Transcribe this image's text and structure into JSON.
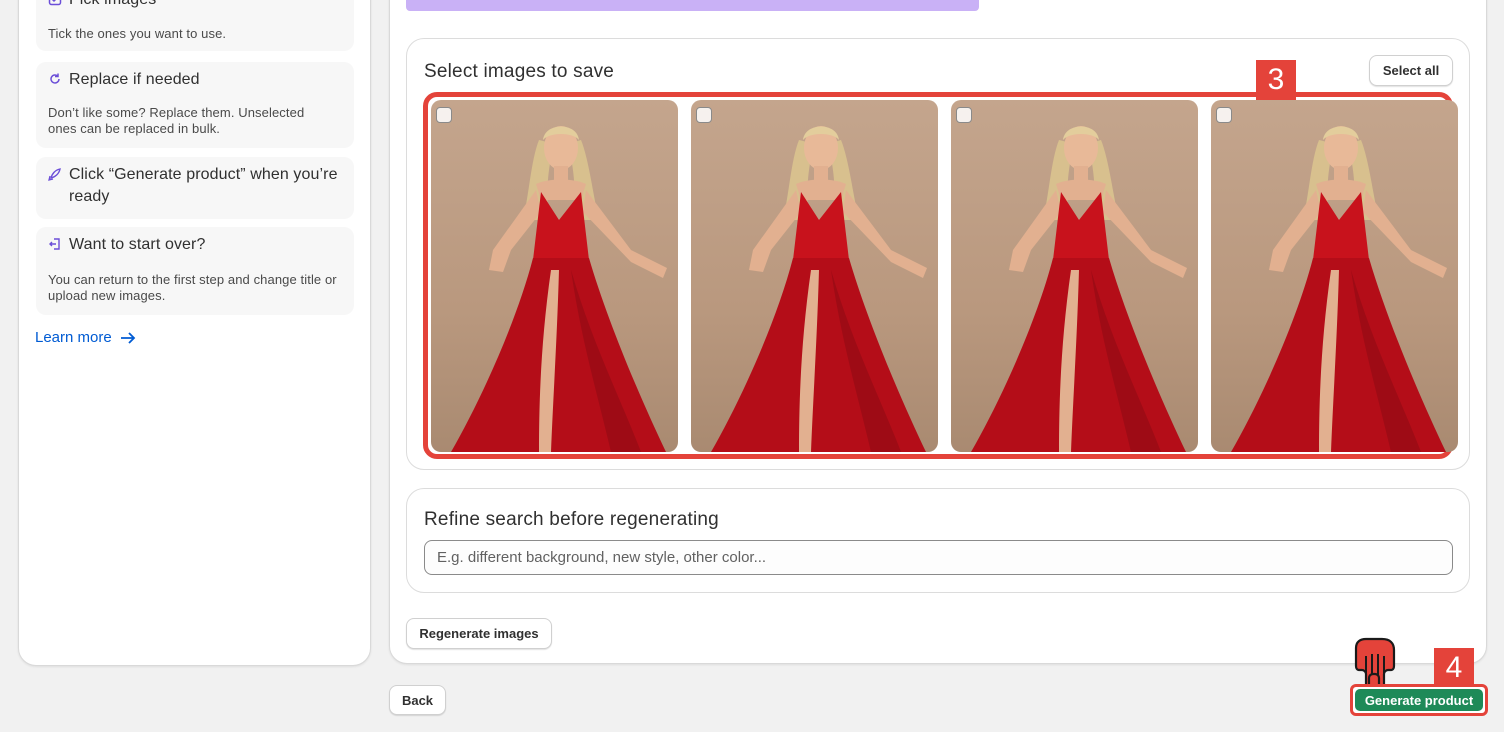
{
  "sidebar": {
    "steps": [
      {
        "title": "Pick images",
        "desc": "Tick the ones you want to use.",
        "icon": "checklist-icon"
      },
      {
        "title": "Replace if needed",
        "desc": "Don’t like some? Replace them. Unselected ones can be replaced in bulk.",
        "icon": "refresh-icon"
      },
      {
        "title": "Click “Generate product” when you’re ready",
        "desc": "",
        "icon": "rocket-icon"
      },
      {
        "title": "Want to start over?",
        "desc": "You can return to the first step and change title or upload new images.",
        "icon": "exit-icon"
      }
    ],
    "learn_more": "Learn more"
  },
  "main": {
    "select_card": {
      "title": "Select images to save",
      "select_all": "Select all",
      "image_count": 4
    },
    "refine_card": {
      "title": "Refine search before regenerating",
      "placeholder": "E.g. different background, new style, other color..."
    },
    "regenerate_label": "Regenerate images"
  },
  "footer": {
    "back_label": "Back",
    "generate_label": "Generate product"
  },
  "annotations": {
    "badge_3": "3",
    "badge_4": "4"
  },
  "colors": {
    "accent_red": "#e4433a",
    "primary_green": "#1e8a58",
    "link_blue": "#005bd3",
    "banner_purple": "#c9b1f6"
  }
}
